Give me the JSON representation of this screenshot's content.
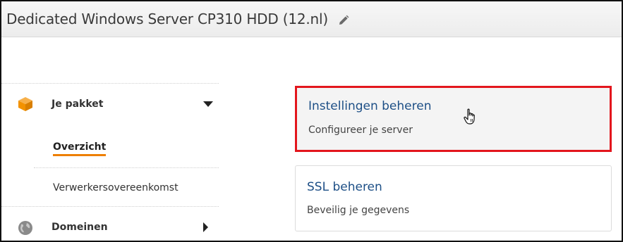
{
  "header": {
    "title": "Dedicated Windows Server CP310 HDD (12.nl)",
    "edit_icon": "pencil-icon"
  },
  "sidebar": {
    "items": [
      {
        "label": "Je pakket",
        "icon": "package-box-icon",
        "icon_color": "#f39200",
        "expanded": true,
        "subitems": [
          {
            "label": "Overzicht",
            "active": true
          },
          {
            "label": "Verwerkersovereenkomst",
            "active": false
          }
        ]
      },
      {
        "label": "Domeinen",
        "icon": "globe-icon",
        "icon_color": "#8a8a8a",
        "expanded": false
      }
    ]
  },
  "cards": [
    {
      "title": "Instellingen beheren",
      "subtitle": "Configureer je server",
      "highlighted": true
    },
    {
      "title": "SSL beheren",
      "subtitle": "Beveilig je gegevens",
      "highlighted": false
    }
  ],
  "colors": {
    "accent_orange": "#ee7f00",
    "link_blue": "#1d4f86",
    "highlight_red": "#e3161d"
  },
  "cursor": "hand-pointer-icon"
}
